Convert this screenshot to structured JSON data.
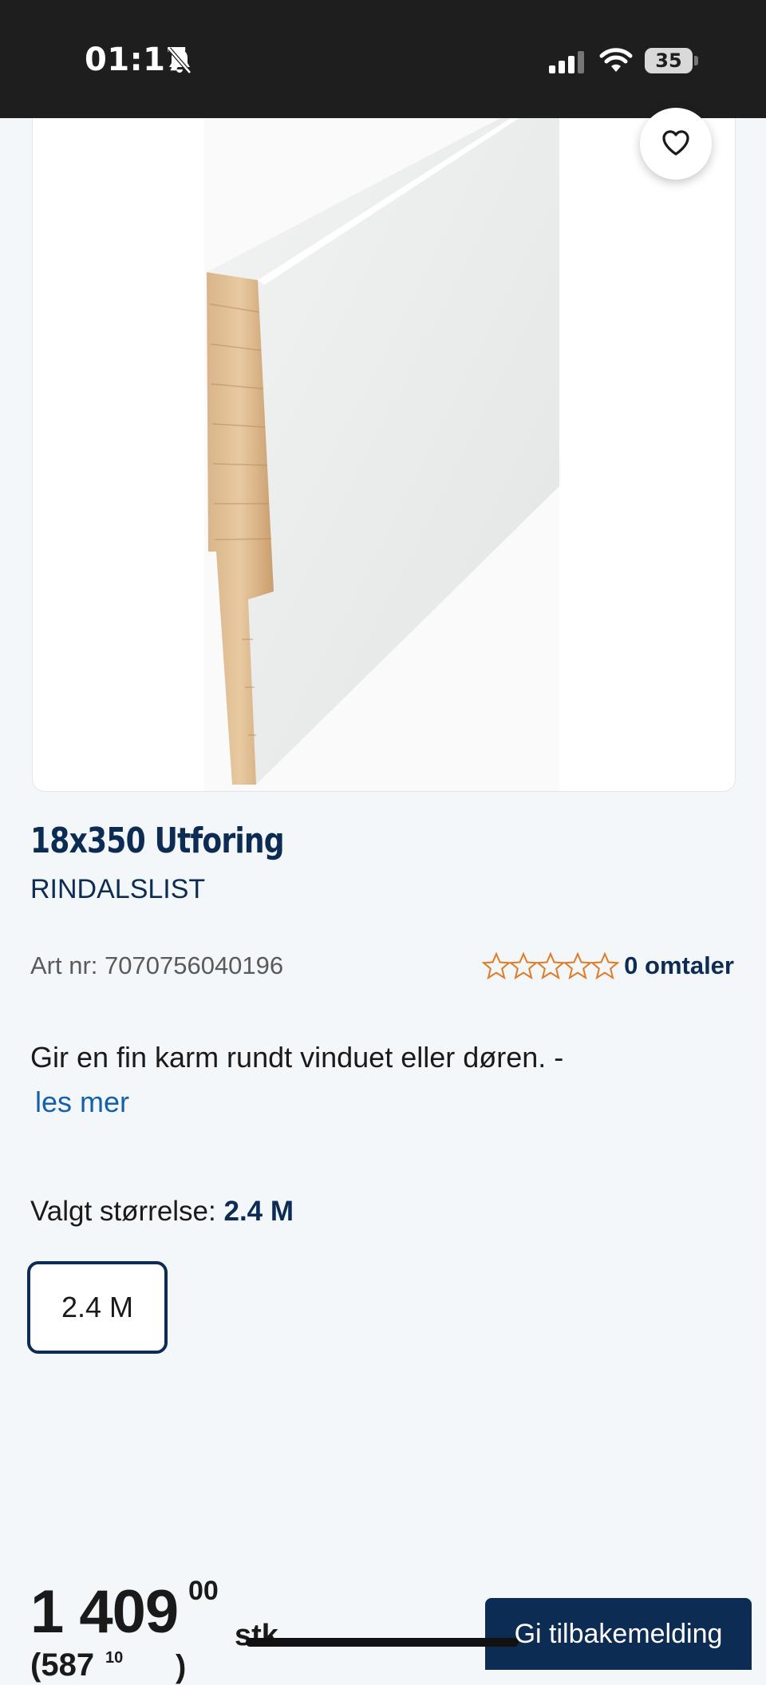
{
  "status_bar": {
    "time": "01:17",
    "battery_level": "35"
  },
  "product": {
    "title": "18x350 Utforing",
    "brand": "RINDALSLIST",
    "art_nr_label": "Art nr: 7070756040196",
    "rating": {
      "stars_filled": 0,
      "stars_total": 5,
      "reviews_label": "0 omtaler",
      "star_color": "#e07b28"
    },
    "description": "Gir en fin karm rundt vinduet eller døren. -",
    "read_more": "les mer"
  },
  "size": {
    "selected_prefix": "Valgt størrelse:",
    "selected_value": "2.4 M",
    "options": [
      "2.4 M"
    ]
  },
  "price": {
    "whole": "1 409",
    "decimals": "00",
    "unit": "stk",
    "unit_price_whole": "(587",
    "unit_price_decimals": "10",
    "unit_price_unit": ")"
  },
  "feedback": {
    "label": "Gi tilbakemelding"
  },
  "colors": {
    "brand_navy": "#0d2c54",
    "link_blue": "#1560a8"
  }
}
